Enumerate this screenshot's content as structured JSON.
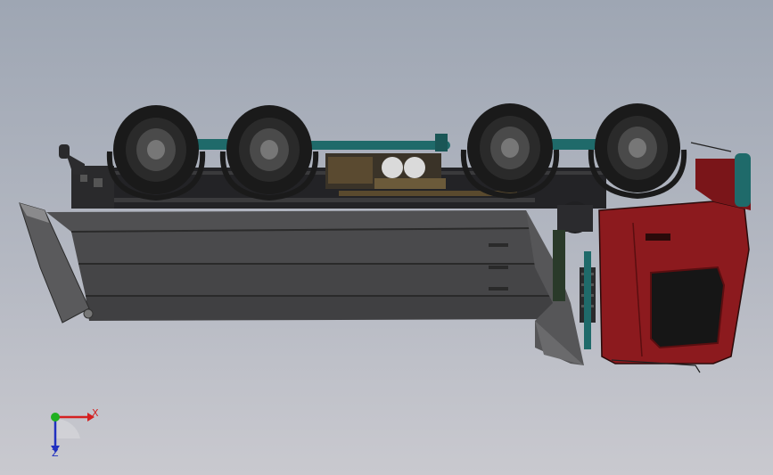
{
  "viewport": {
    "name": "cad-graphics-area",
    "background_top": "#9ea6b3",
    "background_bottom": "#c9c9cf"
  },
  "model": {
    "description_icon": "dump-truck-model",
    "body_color": "#4a4a4c",
    "cab_color": "#8c1a1e",
    "chassis_pipe_color": "#1f6a6a",
    "tire_color": "#1a1a1a"
  },
  "triad": {
    "x_label": "X",
    "z_label": "Z",
    "x_color": "#d42020",
    "y_color": "#20b020",
    "z_color": "#2030c0"
  }
}
